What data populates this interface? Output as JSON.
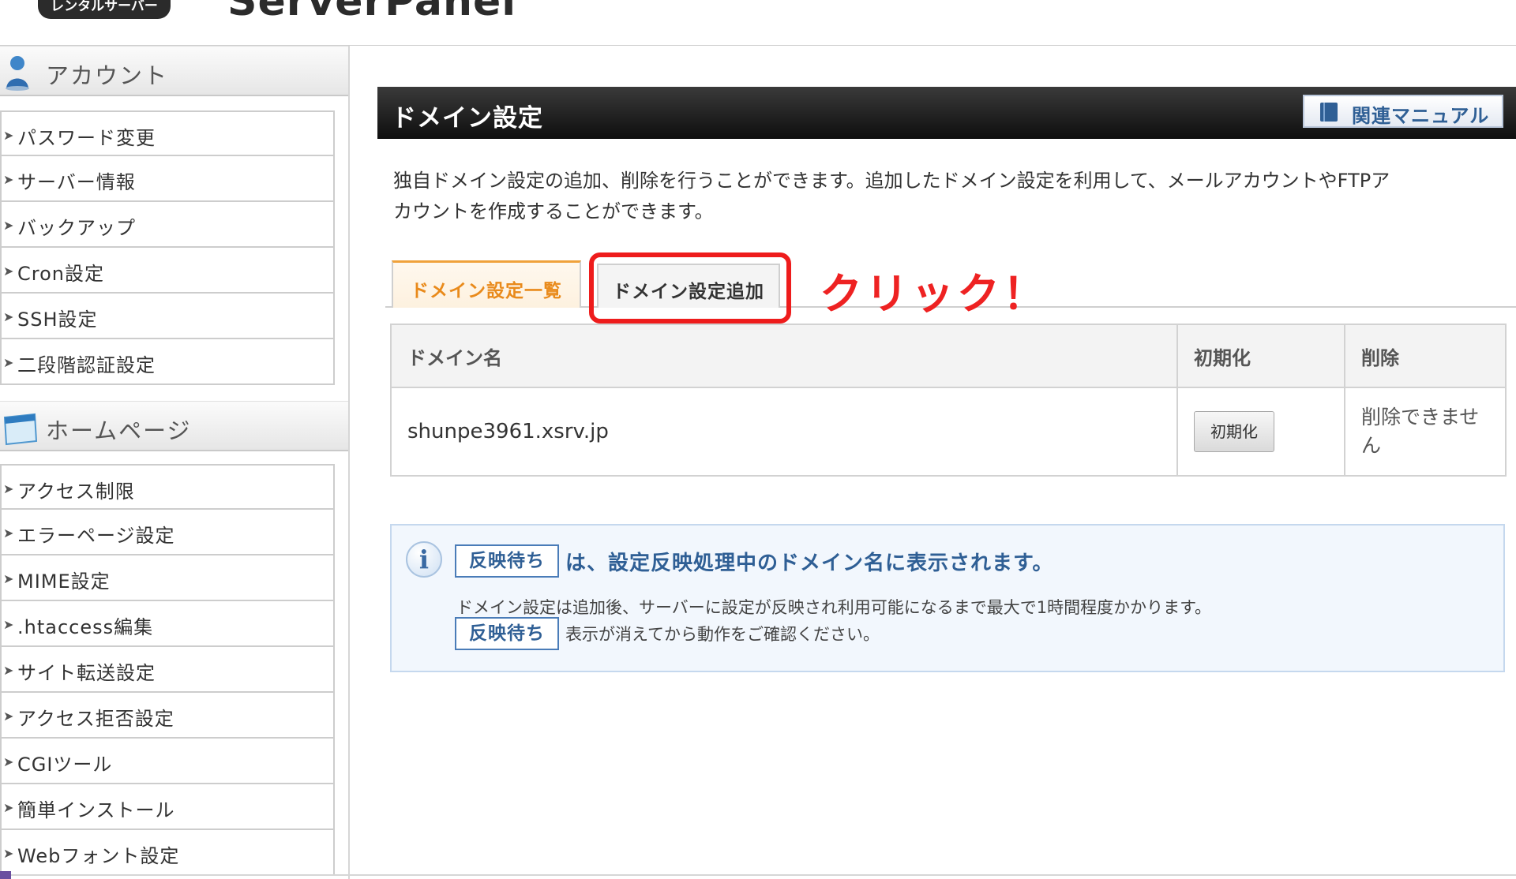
{
  "header": {
    "badge": "レンタルサーバー",
    "title": "ServerPanel"
  },
  "sidebar": {
    "sections": [
      {
        "title": "アカウント",
        "icon": "person-icon",
        "items": [
          "パスワード変更",
          "サーバー情報",
          "バックアップ",
          "Cron設定",
          "SSH設定",
          "二段階認証設定"
        ]
      },
      {
        "title": "ホームページ",
        "icon": "webpage-icon",
        "items": [
          "アクセス制限",
          "エラーページ設定",
          "MIME設定",
          ".htaccess編集",
          "サイト転送設定",
          "アクセス拒否設定",
          "CGIツール",
          "簡単インストール",
          "Webフォント設定"
        ]
      }
    ]
  },
  "panel": {
    "title": "ドメイン設定",
    "manual_label": "関連マニュアル",
    "intro_line1": "独自ドメイン設定の追加、削除を行うことができます。追加したドメイン設定を利用して、メールアカウントやFTPア",
    "intro_line2": "カウントを作成することができます。"
  },
  "tabs": [
    {
      "label": "ドメイン設定一覧",
      "active": true
    },
    {
      "label": "ドメイン設定追加",
      "active": false
    }
  ],
  "annotation": {
    "text": "クリック！",
    "color": "#ee1c1c"
  },
  "table": {
    "headers": [
      "ドメイン名",
      "初期化",
      "削除"
    ],
    "rows": [
      {
        "domain": "shunpe3961.xsrv.jp",
        "init_button": "初期化",
        "delete_text": "削除できません"
      }
    ]
  },
  "info": {
    "tag": "反映待ち",
    "message": "は、設定反映処理中のドメイン名に表示されます。",
    "sub1": "ドメイン設定は追加後、サーバーに設定が反映され利用可能になるまで最大で1時間程度かかります。",
    "sub2": "表示が消えてから動作をご確認ください。"
  },
  "colors": {
    "accent_orange": "#e98a1b",
    "link_blue": "#2f5f95",
    "header_black": "#1a1a1a"
  }
}
